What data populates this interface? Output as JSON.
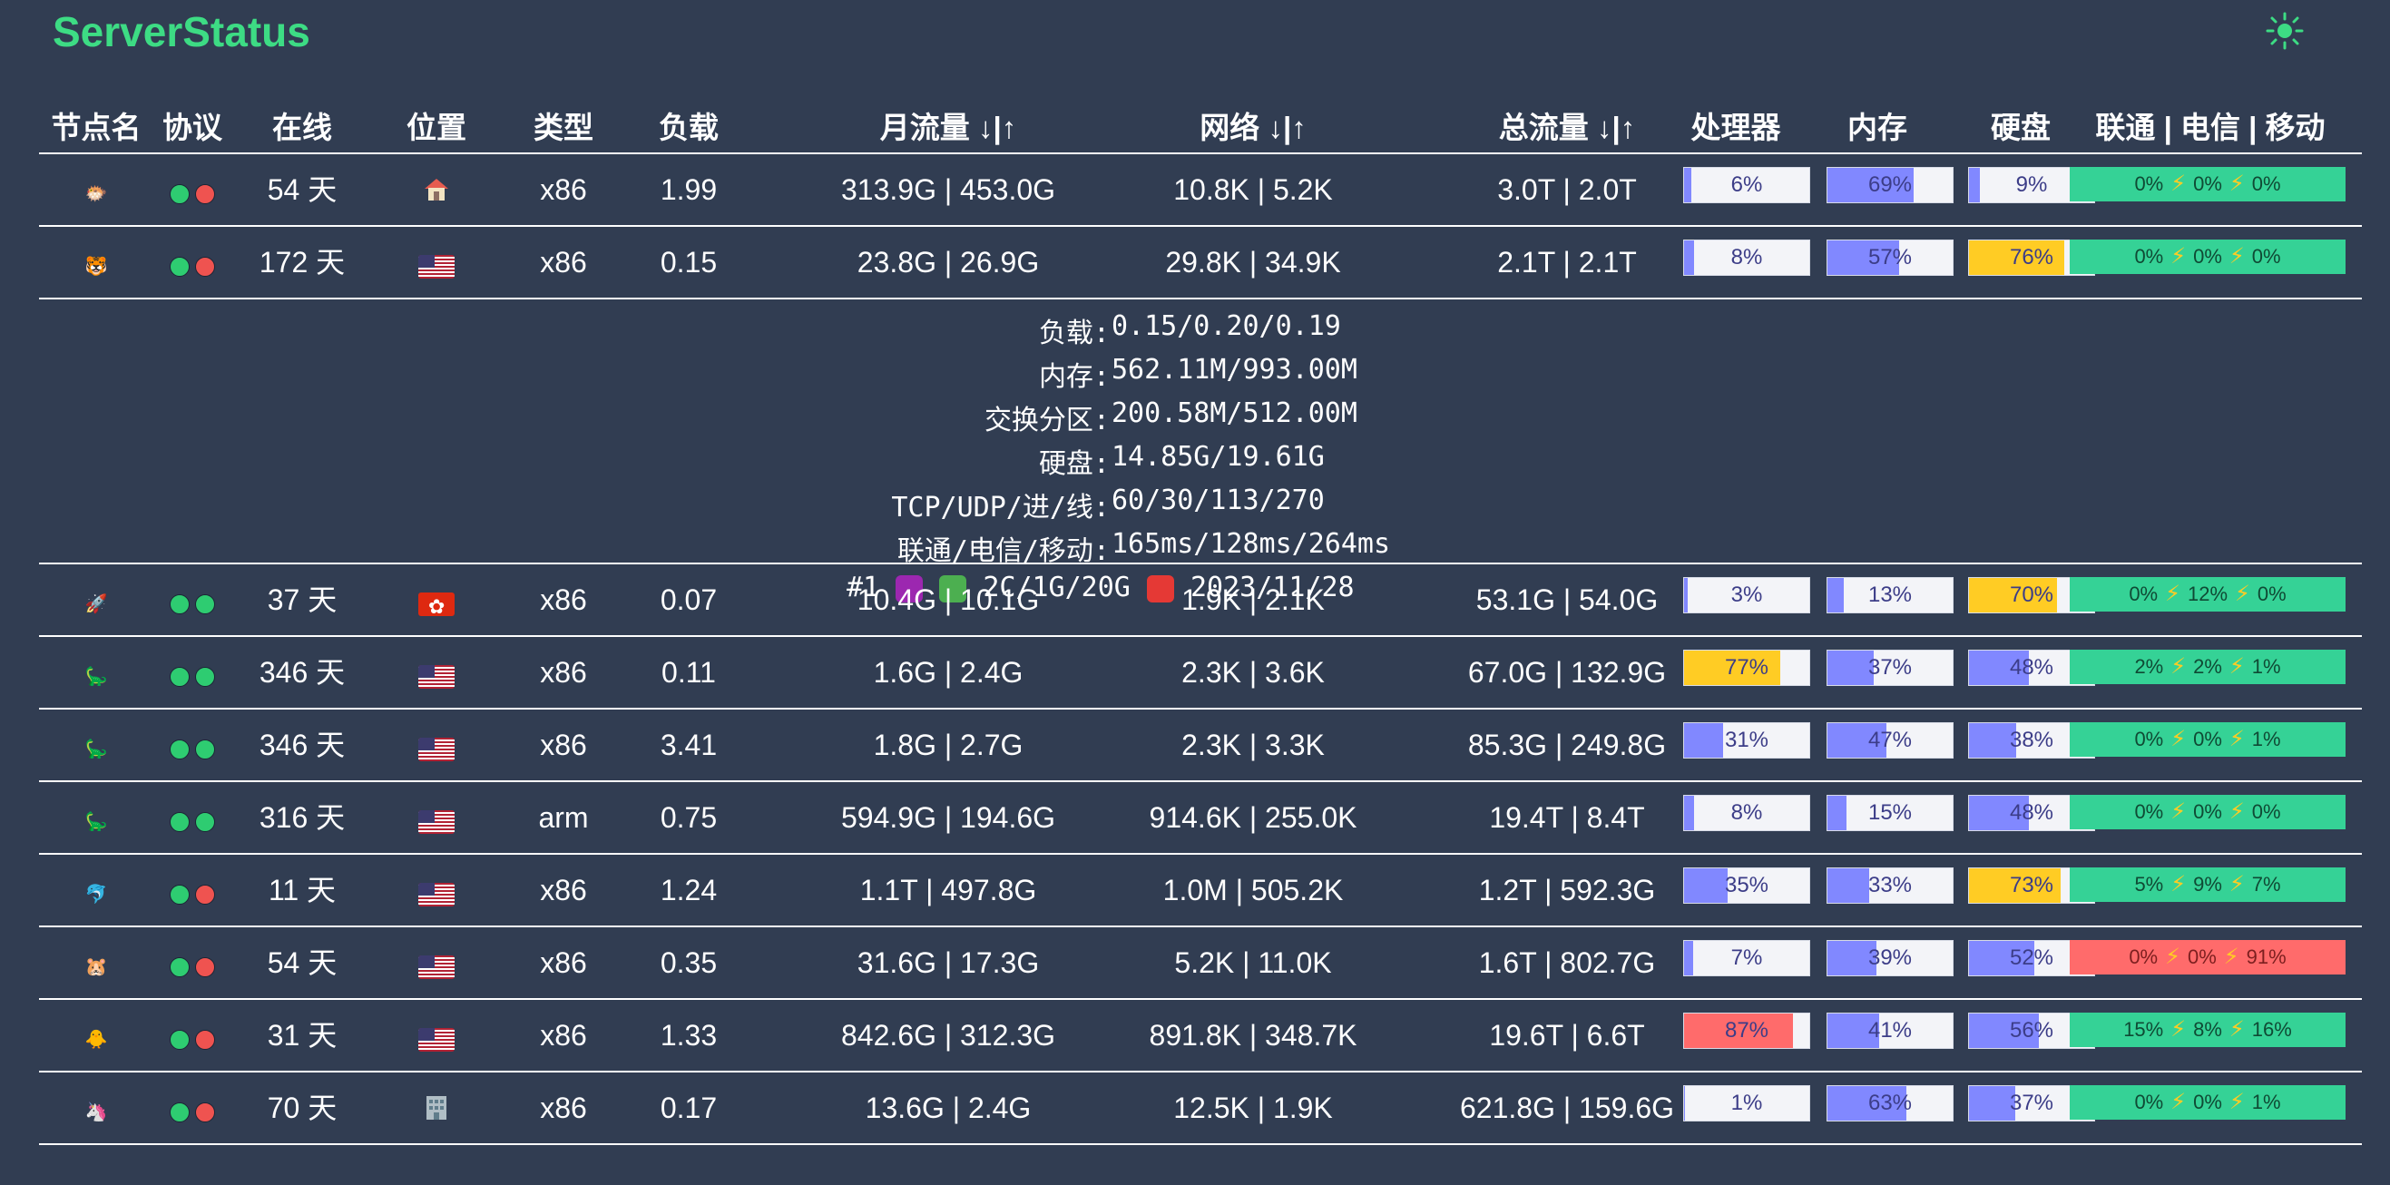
{
  "header": {
    "brand": "ServerStatus",
    "theme_icon": "sun-icon"
  },
  "columns": {
    "name": "节点名",
    "protocol": "协议",
    "online": "在线",
    "location": "位置",
    "type": "类型",
    "load": "负载",
    "month_traffic": "月流量 ↓|↑",
    "network": "网络 ↓|↑",
    "total_traffic": "总流量 ↓|↑",
    "cpu": "处理器",
    "memory": "内存",
    "disk": "硬盘",
    "ping": "联通 | 电信 | 移动"
  },
  "colors": {
    "bg": "#313d52",
    "brand": "#3ddc84",
    "bar_default": "#8188ff",
    "bar_warn": "#ffcc24",
    "bar_danger": "#ff6b6b",
    "ping_ok": "#35d296",
    "ping_bad": "#ff6b6b"
  },
  "rows": [
    {
      "icon": "pufferfish-icon",
      "emoji": "🐡",
      "dots": [
        "green",
        "red"
      ],
      "online": "54 天",
      "location": "house-icon",
      "type": "x86",
      "load": "1.99",
      "month": "313.9G | 453.0G",
      "net": "10.8K | 5.2K",
      "total": "3.0T | 2.0T",
      "cpu": 6,
      "mem": 69,
      "disk": 9,
      "ping": [
        "0%",
        "0%",
        "0%"
      ],
      "ping_status": "ok"
    },
    {
      "icon": "tiger-icon",
      "emoji": "🐯",
      "dots": [
        "green",
        "red"
      ],
      "online": "172 天",
      "location": "us-flag",
      "type": "x86",
      "load": "0.15",
      "month": "23.8G | 26.9G",
      "net": "29.8K | 34.9K",
      "total": "2.1T | 2.1T",
      "cpu": 8,
      "mem": 57,
      "disk": 76,
      "ping": [
        "0%",
        "0%",
        "0%"
      ],
      "ping_status": "ok"
    },
    {
      "icon": "rocket-icon",
      "emoji": "🚀",
      "dots": [
        "green",
        "green"
      ],
      "online": "37 天",
      "location": "hk-flag",
      "type": "x86",
      "load": "0.07",
      "month": "10.4G | 10.1G",
      "net": "1.9K | 2.1K",
      "total": "53.1G | 54.0G",
      "cpu": 3,
      "mem": 13,
      "disk": 70,
      "ping": [
        "0%",
        "12%",
        "0%"
      ],
      "ping_status": "ok"
    },
    {
      "icon": "dinosaur-icon",
      "emoji": "🦕",
      "dots": [
        "green",
        "green"
      ],
      "online": "346 天",
      "location": "us-flag",
      "type": "x86",
      "load": "0.11",
      "month": "1.6G | 2.4G",
      "net": "2.3K | 3.6K",
      "total": "67.0G | 132.9G",
      "cpu": 77,
      "mem": 37,
      "disk": 48,
      "ping": [
        "2%",
        "2%",
        "1%"
      ],
      "ping_status": "ok"
    },
    {
      "icon": "dinosaur-icon",
      "emoji": "🦕",
      "dots": [
        "green",
        "green"
      ],
      "online": "346 天",
      "location": "us-flag",
      "type": "x86",
      "load": "3.41",
      "month": "1.8G | 2.7G",
      "net": "2.3K | 3.3K",
      "total": "85.3G | 249.8G",
      "cpu": 31,
      "mem": 47,
      "disk": 38,
      "ping": [
        "0%",
        "0%",
        "1%"
      ],
      "ping_status": "ok"
    },
    {
      "icon": "dinosaur-icon",
      "emoji": "🦕",
      "dots": [
        "green",
        "green"
      ],
      "online": "316 天",
      "location": "us-flag",
      "type": "arm",
      "load": "0.75",
      "month": "594.9G | 194.6G",
      "net": "914.6K | 255.0K",
      "total": "19.4T | 8.4T",
      "cpu": 8,
      "mem": 15,
      "disk": 48,
      "ping": [
        "0%",
        "0%",
        "0%"
      ],
      "ping_status": "ok"
    },
    {
      "icon": "dolphin-icon",
      "emoji": "🐬",
      "dots": [
        "green",
        "red"
      ],
      "online": "11 天",
      "location": "us-flag",
      "type": "x86",
      "load": "1.24",
      "month": "1.1T | 497.8G",
      "net": "1.0M | 505.2K",
      "total": "1.2T | 592.3G",
      "cpu": 35,
      "mem": 33,
      "disk": 73,
      "ping": [
        "5%",
        "9%",
        "7%"
      ],
      "ping_status": "ok"
    },
    {
      "icon": "hamster-icon",
      "emoji": "🐹",
      "dots": [
        "green",
        "red"
      ],
      "online": "54 天",
      "location": "us-flag",
      "type": "x86",
      "load": "0.35",
      "month": "31.6G | 17.3G",
      "net": "5.2K | 11.0K",
      "total": "1.6T | 802.7G",
      "cpu": 7,
      "mem": 39,
      "disk": 52,
      "ping": [
        "0%",
        "0%",
        "91%"
      ],
      "ping_status": "bad"
    },
    {
      "icon": "chick-icon",
      "emoji": "🐥",
      "dots": [
        "green",
        "red"
      ],
      "online": "31 天",
      "location": "us-flag",
      "type": "x86",
      "load": "1.33",
      "month": "842.6G | 312.3G",
      "net": "891.8K | 348.7K",
      "total": "19.6T | 6.6T",
      "cpu": 87,
      "mem": 41,
      "disk": 56,
      "ping": [
        "15%",
        "8%",
        "16%"
      ],
      "ping_status": "ok"
    },
    {
      "icon": "unicorn-icon",
      "emoji": "🦄",
      "dots": [
        "green",
        "red"
      ],
      "online": "70 天",
      "location": "office-building-icon",
      "type": "x86",
      "load": "0.17",
      "month": "13.6G | 2.4G",
      "net": "12.5K | 1.9K",
      "total": "621.8G | 159.6G",
      "cpu": 1,
      "mem": 63,
      "disk": 37,
      "ping": [
        "0%",
        "0%",
        "1%"
      ],
      "ping_status": "ok"
    }
  ],
  "detail": {
    "lines": [
      {
        "k": "负载:",
        "v": "0.15/0.20/0.19"
      },
      {
        "k": "内存:",
        "v": "562.11M/993.00M"
      },
      {
        "k": "交换分区:",
        "v": "200.58M/512.00M"
      },
      {
        "k": "硬盘:",
        "v": "14.85G/19.61G"
      },
      {
        "k": "TCP/UDP/进/线:",
        "v": "60/30/113/270"
      },
      {
        "k": "联通/电信/移动:",
        "v": "165ms/128ms/264ms"
      }
    ],
    "footer": {
      "rank": "#1",
      "spec": "2C/1G/20G",
      "date": "2023/11/28"
    }
  }
}
